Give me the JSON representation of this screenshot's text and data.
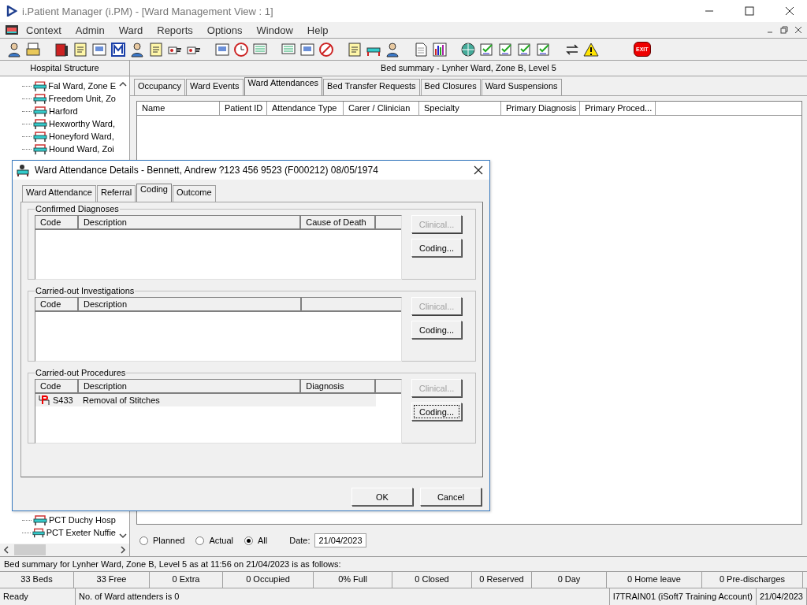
{
  "window": {
    "title": "i.Patient Manager (i.PM) - [Ward Management View : 1]"
  },
  "menu": [
    "Context",
    "Admin",
    "Ward",
    "Reports",
    "Options",
    "Window",
    "Help"
  ],
  "toolbar": {
    "exit_label": "EXIT"
  },
  "left_panel": {
    "header": "Hospital Structure",
    "tree": [
      {
        "label": "Fal Ward, Zone E"
      },
      {
        "label": "Freedom Unit, Zo"
      },
      {
        "label": "Harford"
      },
      {
        "label": "Hexworthy Ward,"
      },
      {
        "label": "Honeyford Ward,"
      },
      {
        "label": "Hound Ward, Zoi"
      },
      {
        "label": "PCT Duchy Hosp"
      },
      {
        "label": "PCT Exeter Nuffie"
      }
    ]
  },
  "summary_header": "Bed summary - Lynher Ward, Zone B, Level 5",
  "tabs": [
    {
      "label": "Occupancy",
      "selected": false
    },
    {
      "label": "Ward Events",
      "selected": false
    },
    {
      "label": "Ward Attendances",
      "selected": true
    },
    {
      "label": "Bed Transfer Requests",
      "selected": false
    },
    {
      "label": "Bed Closures",
      "selected": false
    },
    {
      "label": "Ward Suspensions",
      "selected": false
    }
  ],
  "table": {
    "columns": [
      "Name",
      "Patient ID",
      "Attendance Type",
      "Carer / Clinician",
      "Specialty",
      "Primary Diagnosis",
      "Primary Proced..."
    ]
  },
  "filter": {
    "options": [
      {
        "label": "Planned",
        "selected": false
      },
      {
        "label": "Actual",
        "selected": false
      },
      {
        "label": "All",
        "selected": true
      }
    ],
    "date_label": "Date:",
    "date": "21/04/2023"
  },
  "summary_line": "Bed summary for Lynher Ward, Zone B, Level 5 as at 11:56 on 21/04/2023 is as follows:",
  "counts": [
    "33 Beds",
    "33 Free",
    "0 Extra",
    "0 Occupied",
    "0% Full",
    "0 Closed",
    "0 Reserved",
    "0 Day",
    "0 Home leave",
    "0 Pre-discharges"
  ],
  "status_bar": {
    "state": "Ready",
    "message": "No. of Ward attenders is 0",
    "account": "I7TRAIN01 (iSoft7 Training Account)",
    "date": "21/04/2023"
  },
  "dialog": {
    "title": "Ward Attendance Details - Bennett, Andrew ?123 456 9523 (F000212) 08/05/1974",
    "tabs": [
      {
        "label": "Ward Attendance",
        "selected": false
      },
      {
        "label": "Referral",
        "selected": false
      },
      {
        "label": "Coding",
        "selected": true
      },
      {
        "label": "Outcome",
        "selected": false
      }
    ],
    "groups": [
      {
        "title": "Confirmed Diagnoses",
        "columns": [
          "Code",
          "Description",
          "Cause of Death"
        ],
        "buttons": [
          {
            "label": "Clinical...",
            "disabled": true,
            "focused": false
          },
          {
            "label": "Coding...",
            "disabled": false,
            "focused": false
          }
        ]
      },
      {
        "title": "Carried-out Investigations",
        "columns": [
          "Code",
          "Description"
        ],
        "buttons": [
          {
            "label": "Clinical...",
            "disabled": true,
            "focused": false
          },
          {
            "label": "Coding...",
            "disabled": false,
            "focused": false
          }
        ]
      },
      {
        "title": "Carried-out Procedures",
        "columns": [
          "Code",
          "Description",
          "Diagnosis"
        ],
        "rows": [
          {
            "code": "S433",
            "description": "Removal of Stitches"
          }
        ],
        "buttons": [
          {
            "label": "Clinical...",
            "disabled": true,
            "focused": false
          },
          {
            "label": "Coding...",
            "disabled": false,
            "focused": true
          }
        ]
      }
    ],
    "buttons": [
      "OK",
      "Cancel"
    ]
  }
}
